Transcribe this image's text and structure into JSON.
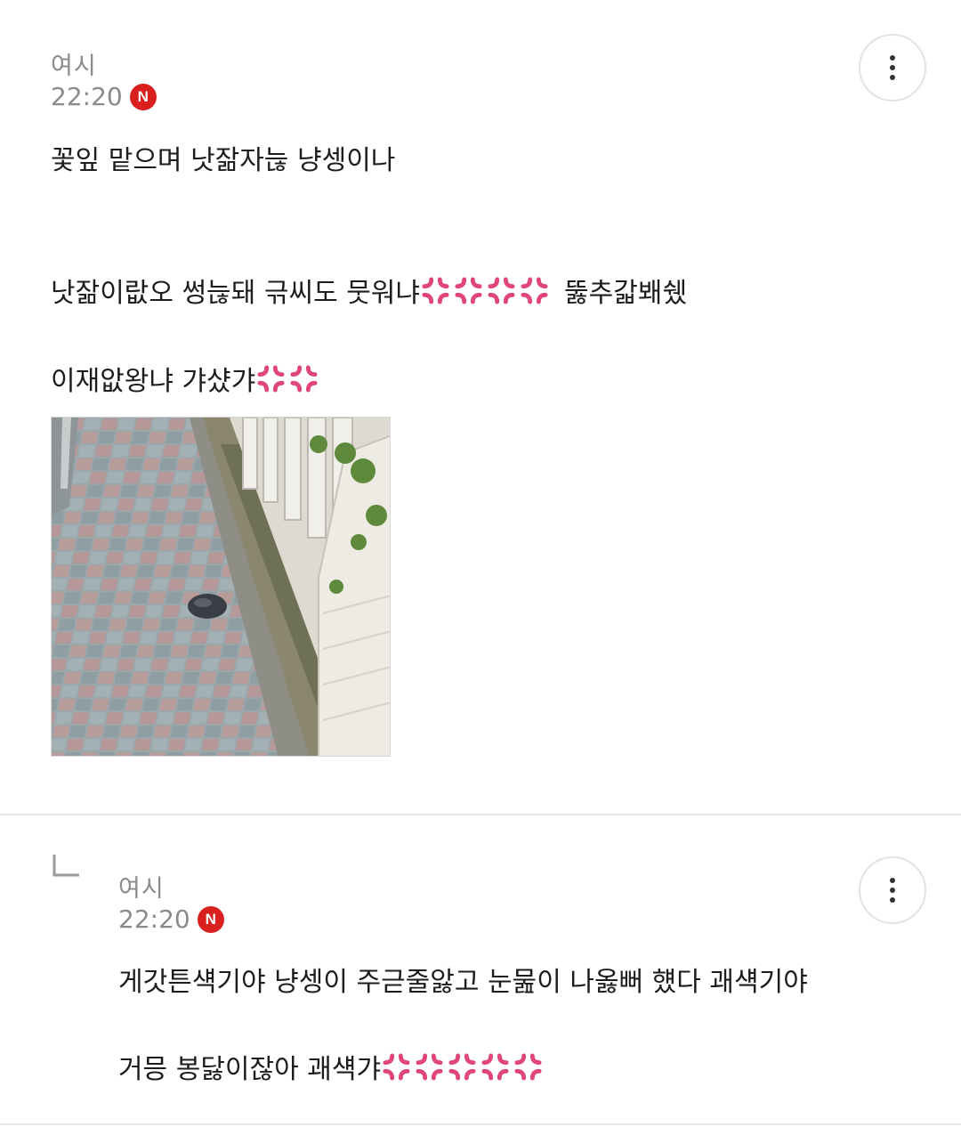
{
  "comments": [
    {
      "author": "여시",
      "time": "22:20",
      "badge": "N",
      "lines": [
        "꽃잎 맡으며 낫잚자늖 냥셍이나",
        "낫잚이랎오 썽늖돼 귺씨도 뭇워냐",
        "뚫추갋봬쉤",
        "이재앖왕냐 갸샸갸"
      ],
      "photo_alt": "sidewalk with fence"
    },
    {
      "author": "여시",
      "time": "22:20",
      "badge": "N",
      "lines": [
        "게갓튼섁기야 냥셍이 주귿줄앓고 눈뭂이 나옳뻐 헀다 괘섁기야",
        "거믕 봉닳이잖아 괘섁갸"
      ]
    }
  ],
  "colors": {
    "badge": "#d9201f",
    "meta_text": "#8a8a8a",
    "divider": "#e6e6e6",
    "anger_emoji": "#e0457b"
  },
  "icons": {
    "more": "more-vertical-icon",
    "reply": "reply-arrow-icon",
    "anger": "anger-symbol-icon"
  }
}
